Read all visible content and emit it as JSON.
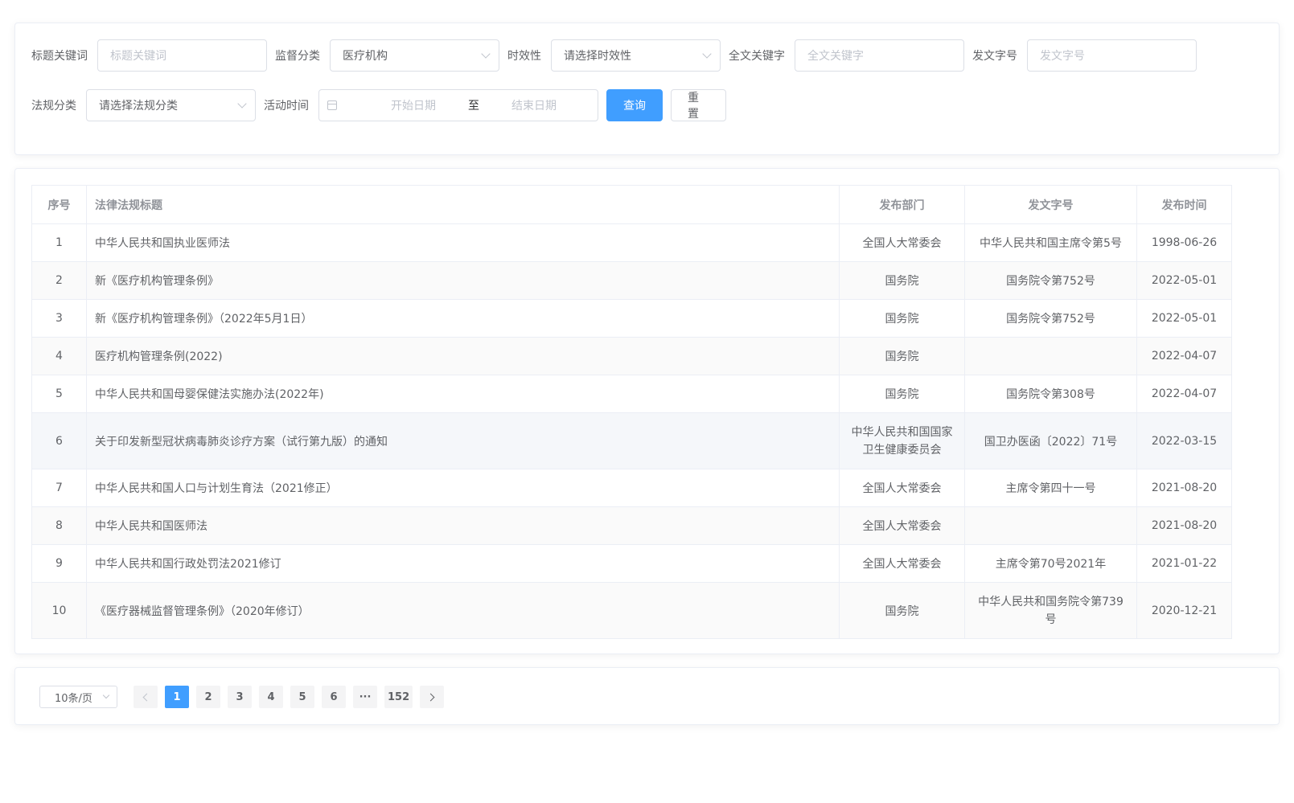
{
  "search": {
    "title_keyword": {
      "label": "标题关键词",
      "placeholder": "标题关键词"
    },
    "supervision": {
      "label": "监督分类",
      "value": "医疗机构"
    },
    "validity": {
      "label": "时效性",
      "placeholder": "请选择时效性"
    },
    "fulltext": {
      "label": "全文关键字",
      "placeholder": "全文关键字"
    },
    "doc_number": {
      "label": "发文字号",
      "placeholder": "发文字号"
    },
    "category": {
      "label": "法规分类",
      "placeholder": "请选择法规分类"
    },
    "activity_time": {
      "label": "活动时间",
      "start_placeholder": "开始日期",
      "separator": "至",
      "end_placeholder": "结束日期"
    },
    "query_button": "查询",
    "reset_button": "重置"
  },
  "table": {
    "headers": [
      "序号",
      "法律法规标题",
      "发布部门",
      "发文字号",
      "发布时间"
    ],
    "rows": [
      {
        "no": "1",
        "title": "中华人民共和国执业医师法",
        "dept": "全国人大常委会",
        "dept2": "",
        "docno": "中华人民共和国主席令第5号",
        "docno2": "",
        "date": "1998-06-26"
      },
      {
        "no": "2",
        "title": "新《医疗机构管理条例》",
        "dept": "国务院",
        "dept2": "",
        "docno": "国务院令第752号",
        "docno2": "",
        "date": "2022-05-01"
      },
      {
        "no": "3",
        "title": "新《医疗机构管理条例》（2022年5月1日）",
        "dept": "国务院",
        "dept2": "",
        "docno": "国务院令第752号",
        "docno2": "",
        "date": "2022-05-01"
      },
      {
        "no": "4",
        "title": "医疗机构管理条例(2022)",
        "dept": "国务院",
        "dept2": "",
        "docno": "",
        "docno2": "",
        "date": "2022-04-07"
      },
      {
        "no": "5",
        "title": "中华人民共和国母婴保健法实施办法(2022年)",
        "dept": "国务院",
        "dept2": "",
        "docno": "国务院令第308号",
        "docno2": "",
        "date": "2022-04-07"
      },
      {
        "no": "6",
        "title": "关于印发新型冠状病毒肺炎诊疗方案（试行第九版）的通知",
        "dept": "中华人民共和国国家",
        "dept2": "卫生健康委员会",
        "docno": "国卫办医函〔2022〕71号",
        "docno2": "",
        "date": "2022-03-15"
      },
      {
        "no": "7",
        "title": "中华人民共和国人口与计划生育法（2021修正）",
        "dept": "全国人大常委会",
        "dept2": "",
        "docno": "主席令第四十一号",
        "docno2": "",
        "date": "2021-08-20"
      },
      {
        "no": "8",
        "title": "中华人民共和国医师法",
        "dept": "全国人大常委会",
        "dept2": "",
        "docno": "",
        "docno2": "",
        "date": "2021-08-20"
      },
      {
        "no": "9",
        "title": "中华人民共和国行政处罚法2021修订",
        "dept": "全国人大常委会",
        "dept2": "",
        "docno": "主席令第70号2021年",
        "docno2": "",
        "date": "2021-01-22"
      },
      {
        "no": "10",
        "title": "《医疗器械监督管理条例》（2020年修订）",
        "dept": "国务院",
        "dept2": "",
        "docno": "中华人民共和国务院令第739",
        "docno2": "号",
        "date": "2020-12-21"
      }
    ]
  },
  "pagination": {
    "page_size": "10条/页",
    "pages": [
      "1",
      "2",
      "3",
      "4",
      "5",
      "6",
      "···",
      "152"
    ],
    "current": "1"
  },
  "colors": {
    "primary": "#409eff",
    "border": "#dcdfe6",
    "placeholder": "#c0c4cc"
  }
}
